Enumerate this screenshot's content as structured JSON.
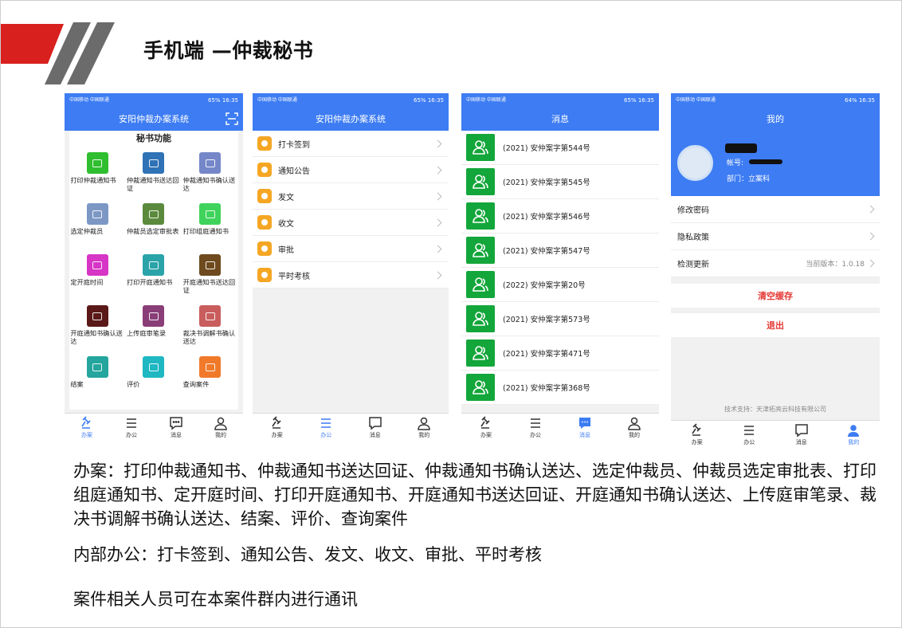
{
  "slide": {
    "title": "手机端 —仲裁秘书"
  },
  "status": {
    "carrier": "中国移动 中国联通",
    "time": "16:35",
    "battery": "65%",
    "battery_alt": "64%"
  },
  "tabs": [
    "办案",
    "办公",
    "消息",
    "我的"
  ],
  "phone1": {
    "app_title": "安阳仲裁办案系统",
    "panel_title": "秘书功能",
    "items": [
      {
        "label": "打印仲裁通知书",
        "color": "#2fbe2f"
      },
      {
        "label": "仲裁通知书送达回证",
        "color": "#2f72b6"
      },
      {
        "label": "仲裁通知书确认送达",
        "color": "#7587c9"
      },
      {
        "label": "选定仲裁员",
        "color": "#7c97c4"
      },
      {
        "label": "仲裁员选定审批表",
        "color": "#5b8a3c"
      },
      {
        "label": "打印组庭通知书",
        "color": "#3fd35c"
      },
      {
        "label": "定开庭时间",
        "color": "#d735c6"
      },
      {
        "label": "打印开庭通知书",
        "color": "#2aa4a9"
      },
      {
        "label": "开庭通知书送达回证",
        "color": "#6e4a1e"
      },
      {
        "label": "开庭通知书确认送达",
        "color": "#5a1818"
      },
      {
        "label": "上传庭审笔录",
        "color": "#8a3e78"
      },
      {
        "label": "裁决书调解书确认送达",
        "color": "#c95d5d"
      },
      {
        "label": "结案",
        "color": "#24a59d"
      },
      {
        "label": "评价",
        "color": "#1eb7c2"
      },
      {
        "label": "查询案件",
        "color": "#f07a2a"
      }
    ]
  },
  "phone2": {
    "app_title": "安阳仲裁办案系统",
    "items": [
      "打卡签到",
      "通知公告",
      "发文",
      "收文",
      "审批",
      "平时考核"
    ]
  },
  "phone3": {
    "title": "消息",
    "items": [
      "(2021) 安仲案字第544号",
      "(2021) 安仲案字第545号",
      "(2021) 安仲案字第546号",
      "(2021) 安仲案字第547号",
      "(2022) 安仲案字第20号",
      "(2021) 安仲案字第573号",
      "(2021) 安仲案字第471号",
      "(2021) 安仲案字第368号"
    ]
  },
  "phone4": {
    "title": "我的",
    "account_label": "帐号:",
    "dept": "部门：立案科",
    "settings": [
      {
        "label": "修改密码",
        "value": ""
      },
      {
        "label": "隐私政策",
        "value": ""
      },
      {
        "label": "检测更新",
        "value": "当前版本：1.0.18"
      }
    ],
    "clear_cache": "清空缓存",
    "logout": "退出",
    "support": "技术支持：天津拓亮云科技有限公司"
  },
  "body": {
    "para1": "办案：打印仲裁通知书、仲裁通知书送达回证、仲裁通知书确认送达、选定仲裁员、仲裁员选定审批表、打印组庭通知书、定开庭时间、打印开庭通知书、开庭通知书送达回证、开庭通知书确认送达、上传庭审笔录、裁决书调解书确认送达、结案、评价、查询案件",
    "para2": "内部办公：打卡签到、通知公告、发文、收文、审批、平时考核",
    "para3": "案件相关人员可在本案件群内进行通讯"
  }
}
